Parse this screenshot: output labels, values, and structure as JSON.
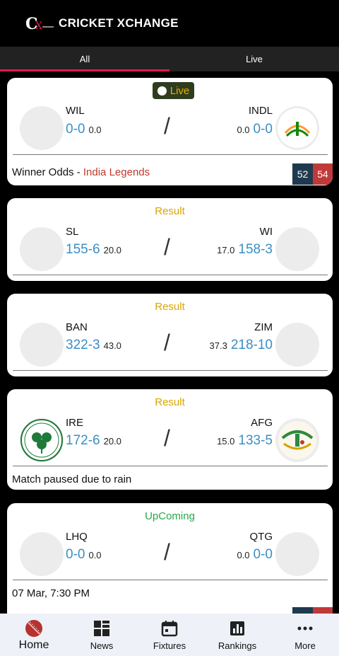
{
  "app": {
    "title": "CRICKET XCHANGE",
    "logo_text": "CX"
  },
  "tabs": [
    {
      "label": "All",
      "active": true
    },
    {
      "label": "Live",
      "active": false
    }
  ],
  "matches": [
    {
      "status": "Live",
      "left": {
        "name": "WIL",
        "score": "0-0",
        "overs": "0.0"
      },
      "right": {
        "name": "INDL",
        "score": "0-0",
        "overs": "0.0"
      },
      "vs": "/",
      "odds_label": "Winner Odds -",
      "odds_team": "India Legends",
      "odds": [
        "52",
        "54"
      ]
    },
    {
      "status": "Result",
      "left": {
        "name": "SL",
        "score": "155-6",
        "overs": "20.0"
      },
      "right": {
        "name": "WI",
        "score": "158-3",
        "overs": "17.0"
      },
      "vs": "/"
    },
    {
      "status": "Result",
      "left": {
        "name": "BAN",
        "score": "322-3",
        "overs": "43.0"
      },
      "right": {
        "name": "ZIM",
        "score": "218-10",
        "overs": "37.3"
      },
      "vs": "/"
    },
    {
      "status": "Result",
      "left": {
        "name": "IRE",
        "score": "172-6",
        "overs": "20.0"
      },
      "right": {
        "name": "AFG",
        "score": "133-5",
        "overs": "15.0"
      },
      "vs": "/",
      "note": "Match paused due to rain"
    },
    {
      "status": "UpComing",
      "left": {
        "name": "LHQ",
        "score": "0-0",
        "overs": "0.0"
      },
      "right": {
        "name": "QTG",
        "score": "0-0",
        "overs": "0.0"
      },
      "vs": "/",
      "date": "07 Mar, 7:30 PM"
    }
  ],
  "bottom_nav": [
    {
      "label": "Home",
      "icon": "cricket-ball-icon",
      "active": true
    },
    {
      "label": "News",
      "icon": "news-grid-icon",
      "active": false
    },
    {
      "label": "Fixtures",
      "icon": "calendar-icon",
      "active": false
    },
    {
      "label": "Rankings",
      "icon": "bar-chart-icon",
      "active": false
    },
    {
      "label": "More",
      "icon": "more-dots-icon",
      "active": false
    }
  ],
  "colors": {
    "accent": "#e0174f",
    "score": "#3a8fc4",
    "result": "#d9a500",
    "upcoming": "#2aa84a",
    "odds_back": "#1f3a4e",
    "odds_lay": "#c0393a"
  }
}
